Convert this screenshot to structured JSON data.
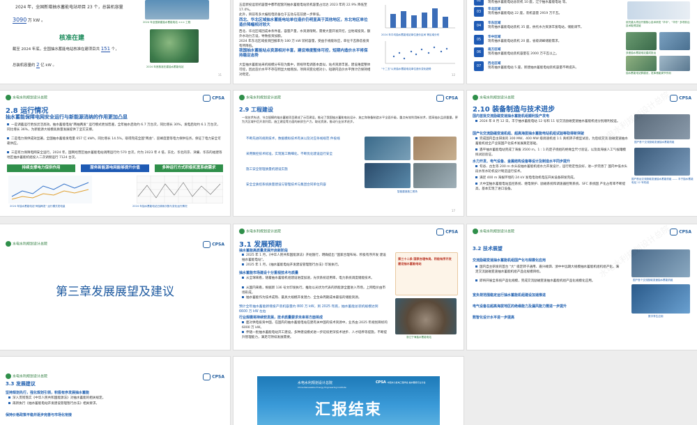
{
  "slide_r0c1": {
    "line1": "2024 年，全国新增抽水蓄能电站项目 23 个，总装机容量",
    "line1_num": "23",
    "cap_num": "3090",
    "cap_unit": "万 kW 。",
    "heading": "核准在建",
    "line2": "截至 2024 年底，全国抽水蓄能电站核准在建项目共",
    "line2_num": "151",
    "line2_tail": "个，",
    "line3": "总装机容量约",
    "line3_num": "2",
    "line3_tail": "亿 kW 。",
    "img_cap1": "2024 年全国新建抽水蓄能电站 ××× 工程",
    "img_cap2": "2024 年底核准在建抽水蓄能电站"
  },
  "slide_r0c2": {
    "p1": "五是新投运装机容量中都市配套的抽水蓄能电站装机容量占比达 2023 年的 22.9% 降低至 17.4%。",
    "p2": "此外，目前有多大编程电装备位于五动与在前建一步降低。",
    "h1": "西北、华北区域抽水蓄能电站单位造价仍明显高于其他地区，东北地区单位造价降幅相对较大",
    "p3": "西北、华北区域因成本条件差，容量产量，水资源限制，需要大量开发开挖，业地域投资，额外水动力方设，导致投资加额。",
    "p4": "2024 年东北区域投资回报率为 180 万 kW 装机容量，受益于规能效应，单位千瓦静态投资有所降低。",
    "h2": "我国抽水蓄能站点资源相对丰富，建设难度整体可控，短期内造价水平将保持稳定态势",
    "p5": "大型抽水蓄能站采机规模分布较为集中，新规项电调基本类似，站点资源丰富，建设难度整体可控，因此造价水平不存在明显大幅增加，项目间变化相对小，短期内造价水平预计仍保持相对稳定。",
    "cap1": "2024 年平均抽水蓄能电站单位造价区间 等区域分布",
    "cap2": "\"十二五\"以来抽水蓄能电站单位造价变化趋势"
  },
  "slide_r0c3": {
    "items": [
      {
        "no": "02",
        "title": "东北区域",
        "text": "现有抽水蓄能电站总装机 10 座，辽宁抽水蓄能电站 等。"
      },
      {
        "no": "03",
        "title": "华北区域",
        "text": "现有抽水蓄能电站 22 座，装机容量 2919 万千瓦。"
      },
      {
        "no": "04",
        "title": "华东区域",
        "text": "现有抽水蓄能电站装机 35 座，依托水力资源丰富电站，储能调节。"
      },
      {
        "no": "05",
        "title": "华中区域",
        "text": "现有抽水蓄能电站装机 20 座，省级调峰储能需求。"
      },
      {
        "no": "06",
        "title": "南方区域",
        "text": "现有抽水蓄能电站装机容量在 2000 万千瓦以上。"
      },
      {
        "no": "07",
        "title": "西北区域",
        "text": "现有抽水蓄能电站 5 座，新建抽水蓄能电站装机容量不断提升。"
      }
    ],
    "cap1": "依托重大项目开展核心技术研发 \"华中\"、\"华东\" 多项前沿技术取得突破",
    "cap2": "多座抽水蓄能电站建成投运",
    "cap3": "抽水蓄能电站群建设，发挥储能调节作用"
  },
  "slide_r1c1": {
    "title": "2.8 运行情况",
    "subtitle": "抽水蓄能保障电网安全运行与新能源消纳的作用更加凸显",
    "b1": "一是调蓄运行更加灵活高效。抽水蓄能电站\"两抽两发\" 运行模式更加普遍，全年抽水启动约 6.7 万台次，同比增长 30%，发电启动约 6.1 万台次，同比增长 36%，为新能源大规模高质量发展提供了坚实支撑。",
    "b2": "二是电力保供成效显著。全国抽水蓄能发电量 657 亿 kWh，同比增长 14.5%，取得完成全国\"两会\"、迎峰度夏等电力保供任务，保证了电力安全可靠供应。",
    "b3": "三是有力保障电网安全运行。2024 年，国网经营区抽水蓄能电站调用运行约 570 台次，约为 2023 年 4 倍，东北、华北的京、津冀、华东的福建等地区抽水蓄能机组投入二次调频运行 7124 台次。",
    "bar1": "持续支撑电力保供作用",
    "bar2": "服务新能源电网能够提升价值",
    "bar3": "多种运行方式积极拓宽系统需求",
    "cap1": "2024 年抽水蓄能电站\"两抽两发\" 运行模式发电量",
    "cap2": "2024 年抽水蓄能电站日调用次数与变化运行情况"
  },
  "slide_r1c2": {
    "title": "2.9 工程建设",
    "intro": "一批技术先进、节点规模的抽水蓄能项目建成了示范建设，推动了我国抽水蓄能电站设计、施工和装备制造水平全面升级，重点有效利用新技术，提高抽水品质量量，更为大区域中后开发利用，施工建设等方面的新质生产力，取化资源，推动行业技术进步。",
    "items": [
      "不断先进的规则技术，数据模拟技术有关以及对应条线规范 件投线",
      "采用数控技术标准，实现施工精细化，不断优化建设运行安全",
      "施工安全管理质量机建设实施",
      "安全全质控系统质量建设与管理技术与集团合同单位内容"
    ],
    "cap": "智能建造施工现场"
  },
  "slide_r1c3": {
    "title": "2.10 装备制造与技术进步",
    "sub1": "国内首批交流励磁变速抽水蓄能机组顺利投产发电",
    "p1": "2024 年 8 月 12 日，丰宁抽水蓄能电站 12 号和 11 号交流励磁变速抽水蓄能机组分别顺利投运。",
    "sub2": "国产化交流励磁变速机组、超高海拔抽水蓄能电站机组试验等取得新突破",
    "p2": "完成国内自主研发的 300 MW、400 MW 级调速机组 1:1 真机转子模型试验，为后续交流 励磁变速抽水蓄能机组全产业链国产化技术发展奠定基础。",
    "p3": "遇平抽水蓄能电站完成了海拔 3500 m，1 : 1 的定子绕组的绝缘全尺寸验证，以及高海拔人工气候罐模拟试验验证。",
    "sub3": "水力开发、电气设备、金属结构设备等设计及制造水平同步提升",
    "p4": "旬谷、古生等 200 m 水头段抽水蓄能机组水力开发设计，运行稳定性良好，进一步完善了 国内中低水头段水泵水轮机设计制造运行技术。",
    "p5": "满足 400 m 海拔环境的 24 kV 发电电动机电压开关设备研发完成。",
    "p6": "大中型抽水蓄能电站监控系统、继电保护、励磁系统和调速器控制系统、SFC 系统国 产化占有率不断提高，基本实现了进口设备。",
    "cap1": "国产首个交流励磁变速抽水蓄能机组",
    "cap2": "国产首台交流励磁变速抽水蓄能机组 —— 丰宁抽水蓄能电站 12 号机组"
  },
  "slide_r2c1": {
    "title": "第三章发展展望及建议"
  },
  "slide_r2c2": {
    "title": "3.1 发展预期",
    "sub1": "抽水蓄能高质量发展开启新阶段",
    "p1": "2025 年 1 月，《中华人民共和国能源法》开始施行，明确提出 \"国家合理布局、积极有序开发 建设抽水蓄能电站\"。",
    "p2": "2025 年 1 月，《抽水蓄能电站开发建设管理暂行办法》印发执行。",
    "sub2": "抽水蓄能市场建设十分重视技术与质量",
    "p3": "从全球来看，随着抽水蓄能机组建设进度加速，光伏系统适用率，电力系统调度储能技术。",
    "p4": "从国内来看，根据新 136 号文印发执行，推动以光伏为代表的新能源全面进入市场，上网电价由市场形成。",
    "p5": "抽水蓄能作为技术成熟、最具大规模开发潜力、全生命周期成本最低的储能资源。",
    "sub3": "预计全年抽水蓄能新增投产装机容量约 800 万 kW，到 2025 年底，抽水蓄能总装机规模达到 6600 万 kW 左右",
    "sub4": "行业规模将持续较发展，技术质量要求未来将方面将成",
    "p6": "面对供电投资中国，在国内的抽水蓄能电站在建有关中国的技术资源中，业务由 2025 年规划目标的 6000 万 kW。",
    "p7": "伴随一批抽水蓄能电站开工建设，多种建设模式进一步延续更深技术进步、人才培养等提施，不断提升管理能力，满足可持续发展需要。",
    "newscap": "第三十二条 国家合理布局、积极有序开发建设抽水蓄能电站",
    "cap": "浙江宁海抽水蓄能电站"
  },
  "slide_r2c3": {
    "title": "3.2 技术展望",
    "sub1": "交流励磁变速抽水蓄能机组国产化与规模化应用",
    "p1": "国内自主研发的首台 \"大\" 级定转子通用、嘉兴嵊泗、浙中中远期大规模抽水蓄能机组机组产化，满足交流励磁变速抽水蓄能机组产品化规模目标。",
    "p2": "即将开展全系统产品化规模，完成交流励磁变速抽水蓄能机组产品化规模化应用。",
    "sub2": "宽负荷范围稳定运行抽水蓄能机组建设加速推进",
    "sub3": "电气设备在超高海拔地区的绝缘能力及漏风能力需进一步提升",
    "sub4": "数智化设计水平进一步提高",
    "cap1": "国产首个交流励磁变速抽水蓄能机组",
    "cap2": "数字孪生应用"
  },
  "slide_r3c1": {
    "title": "3.3 发展建议",
    "sub1": "坚持规划先行，强化规划引领，积极有序发展抽水蓄能",
    "p1": "深入贯彻落实《中华人民共和国能源法》对抽水蓄能的相关规定。",
    "p2": "再新执行《抽水蓄能电站开发建设管理暂行办法》相关要求。",
    "sub2": "保持价格政策平稳并逐步完善与市场化衔接"
  },
  "slide_r3c2": {
    "org_cn": "水电水利规划设计总院",
    "org_en": "China Renewable Energy Engineering Institute",
    "brand": "CPSA",
    "brand_cn": "中国水力发电工程学会 抽水蓄能行业分会",
    "title": "汇报结束"
  },
  "common": {
    "logo_text": "水电水利规划设计总院",
    "brand": "CPSA",
    "watermark": "水电水利规划设计总院"
  }
}
